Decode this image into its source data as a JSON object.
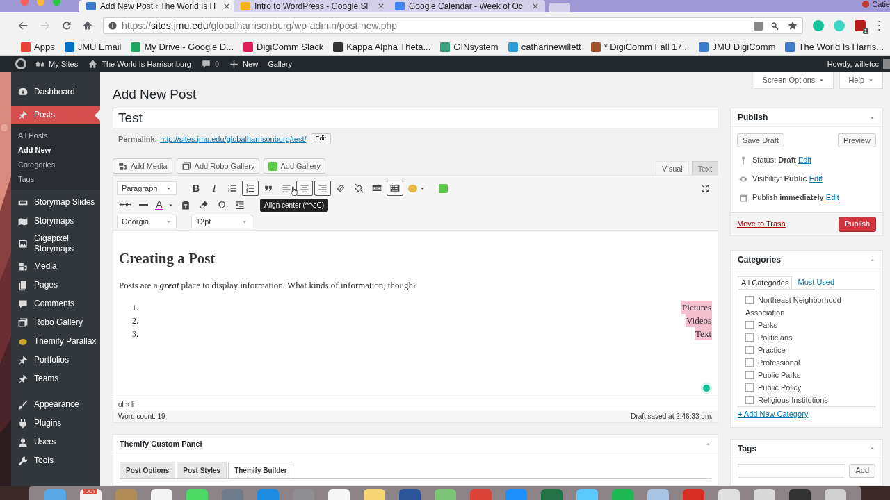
{
  "browser": {
    "tabs": [
      {
        "title": "Add New Post ‹ The World Is H",
        "selected": true,
        "color": "#3b7ccc"
      },
      {
        "title": "Intro to WordPress - Google Sl",
        "selected": false,
        "color": "#f4b400"
      },
      {
        "title": "Google Calendar - Week of Oc",
        "selected": false,
        "color": "#4285f4"
      }
    ],
    "profile": "Catie",
    "url": {
      "scheme": "https://",
      "host": "sites.jmu.edu",
      "path": "/globalharrisonburg/wp-admin/post-new.php"
    },
    "extension_badge": "1",
    "bookmarks": [
      {
        "label": "Apps",
        "color": "#e94235"
      },
      {
        "label": "JMU Email",
        "color": "#0072c6"
      },
      {
        "label": "My Drive - Google D...",
        "color": "#1fa463"
      },
      {
        "label": "DigiComm Slack",
        "color": "#e01e5a"
      },
      {
        "label": "Kappa Alpha Theta...",
        "color": "#333333"
      },
      {
        "label": "GINsystem",
        "color": "#3aa17e"
      },
      {
        "label": "catharinewillett",
        "color": "#2d9cdb"
      },
      {
        "label": "* DigiComm Fall 17...",
        "color": "#a0522d"
      },
      {
        "label": "JMU DigiComm",
        "color": "#3b7ccc"
      },
      {
        "label": "The World Is Harris...",
        "color": "#3b7ccc"
      }
    ]
  },
  "admin_bar": {
    "items": [
      {
        "label": "My Sites"
      },
      {
        "label": "The World Is Harrisonburg"
      },
      {
        "label": "0"
      },
      {
        "label": "New"
      },
      {
        "label": "Gallery"
      }
    ],
    "greeting": "Howdy, willetcc"
  },
  "sidebar": {
    "groups": [
      [
        {
          "label": "Dashboard",
          "selected": false
        }
      ],
      [
        {
          "label": "Posts",
          "selected": true,
          "children": [
            {
              "label": "All Posts",
              "selected": false
            },
            {
              "label": "Add New",
              "selected": true
            },
            {
              "label": "Categories",
              "selected": false
            },
            {
              "label": "Tags",
              "selected": false
            }
          ]
        },
        {
          "label": "Storymap Slides",
          "selected": false
        },
        {
          "label": "Storymaps",
          "selected": false
        },
        {
          "label": "Gigapixel Storymaps",
          "selected": false
        },
        {
          "label": "Media",
          "selected": false
        },
        {
          "label": "Pages",
          "selected": false
        },
        {
          "label": "Comments",
          "selected": false
        },
        {
          "label": "Robo Gallery",
          "selected": false
        },
        {
          "label": "Themify Parallax",
          "selected": false
        },
        {
          "label": "Portfolios",
          "selected": false
        },
        {
          "label": "Teams",
          "selected": false
        }
      ],
      [
        {
          "label": "Appearance",
          "selected": false
        },
        {
          "label": "Plugins",
          "selected": false
        },
        {
          "label": "Users",
          "selected": false
        },
        {
          "label": "Tools",
          "selected": false
        }
      ]
    ]
  },
  "page": {
    "title": "Add New Post",
    "screen_options": "Screen Options",
    "help": "Help"
  },
  "post": {
    "title_value": "Test",
    "permalink_label": "Permalink:",
    "permalink_url": "http://sites.jmu.edu/globalharrisonburg/test/",
    "permalink_edit": "Edit"
  },
  "media_buttons": [
    {
      "label": "Add Media"
    },
    {
      "label": "Add Robo Gallery"
    },
    {
      "label": "Add Gallery"
    }
  ],
  "editor_tabs": [
    {
      "label": "Visual",
      "selected": true
    },
    {
      "label": "Text",
      "selected": false
    }
  ],
  "toolbar": {
    "rows": [
      [
        {
          "kind": "select",
          "value": "Paragraph"
        },
        {
          "kind": "bold",
          "label": "B",
          "active": false
        },
        {
          "kind": "italic",
          "label": "I",
          "active": false
        },
        {
          "kind": "bullet-list",
          "active": false
        },
        {
          "kind": "numbered-list",
          "active": true
        },
        {
          "kind": "quote",
          "active": false
        },
        {
          "kind": "align-left",
          "active": false
        },
        {
          "kind": "align-center",
          "active": true
        },
        {
          "kind": "align-right",
          "active": true
        },
        {
          "kind": "link",
          "active": false
        },
        {
          "kind": "unlink",
          "active": false
        },
        {
          "kind": "read-more",
          "active": false
        },
        {
          "kind": "toolbar-toggle",
          "active": true
        },
        {
          "kind": "emoji",
          "active": false
        },
        {
          "kind": "square",
          "active": false
        }
      ],
      [
        {
          "kind": "strikethrough",
          "label": "ABC",
          "active": false
        },
        {
          "kind": "horizontal-line",
          "active": false
        },
        {
          "kind": "text-color",
          "label": "A",
          "active": false
        },
        {
          "kind": "paste-text",
          "active": false
        },
        {
          "kind": "eraser",
          "active": false
        },
        {
          "kind": "special-character",
          "label": "Ω",
          "active": false
        },
        {
          "kind": "outdent",
          "active": false
        }
      ],
      [
        {
          "kind": "select",
          "value": "Georgia"
        },
        {
          "kind": "select",
          "value": "12pt"
        }
      ]
    ],
    "tooltip": "Align center (^⌥C)"
  },
  "content": {
    "heading": "Creating a Post",
    "paragraph": [
      {
        "text": "Posts are a "
      },
      {
        "text": "great",
        "bold": true,
        "italic": true
      },
      {
        "text": " place to display information. What kinds of information, though?"
      }
    ],
    "list": [
      {
        "number": "1.",
        "text": "Pictures"
      },
      {
        "number": "2.",
        "text": "Videos"
      },
      {
        "number": "3.",
        "text": "Text"
      }
    ]
  },
  "path": "ol » li",
  "word_count": "Word count: 19",
  "saved": "Draft saved at 2:46:33 pm.",
  "custom_panel": {
    "title": "Themify Custom Panel",
    "tabs": [
      {
        "label": "Post Options",
        "selected": false
      },
      {
        "label": "Post Styles",
        "selected": false
      },
      {
        "label": "Themify Builder",
        "selected": true
      }
    ]
  },
  "publish": {
    "title": "Publish",
    "save_draft": "Save Draft",
    "preview": "Preview",
    "rows": [
      {
        "text": "Status: **Draft**",
        "link": "Edit"
      },
      {
        "text": "Visibility: **Public**",
        "link": "Edit"
      },
      {
        "text": "Publish **immediately**",
        "link": "Edit"
      }
    ],
    "trash": "Move to Trash",
    "publish_button": "Publish"
  },
  "categories": {
    "title": "Categories",
    "tabs": [
      {
        "label": "All Categories",
        "selected": true
      },
      {
        "label": "Most Used",
        "selected": false
      }
    ],
    "items": [
      {
        "label": "Northeast Neighborhood Association",
        "checked": false
      },
      {
        "label": "Parks",
        "checked": false
      },
      {
        "label": "Politicians",
        "checked": false
      },
      {
        "label": "Practice",
        "checked": false
      },
      {
        "label": "Professional",
        "checked": false
      },
      {
        "label": "Public Parks",
        "checked": false
      },
      {
        "label": "Public Policy",
        "checked": false
      },
      {
        "label": "Religious Institutions",
        "checked": false
      }
    ],
    "add_new": "+ Add New Category"
  },
  "tags": {
    "title": "Tags",
    "add": "Add"
  },
  "dock": {
    "items": [
      {
        "color": "#5aa9e6"
      },
      {
        "color": "#f2f2f2",
        "label": "OCT"
      },
      {
        "color": "#b08d57"
      },
      {
        "color": "#f5f5f5"
      },
      {
        "color": "#4cd964"
      },
      {
        "color": "#6d7b8d"
      },
      {
        "color": "#1d8ce0"
      },
      {
        "color": "#8e8e93"
      },
      {
        "color": "#f6f6f6"
      },
      {
        "color": "#f7d774"
      },
      {
        "color": "#2b579a"
      },
      {
        "color": "#7cc576"
      },
      {
        "color": "#db4437"
      },
      {
        "color": "#1e90ff"
      },
      {
        "color": "#217346"
      },
      {
        "color": "#5ac8fa"
      },
      {
        "color": "#1db954"
      },
      {
        "color": "#a7c4e5"
      },
      {
        "color": "#d93025"
      },
      {
        "color": "#e0e0e0"
      },
      {
        "color": "#d9d9d9"
      },
      {
        "color": "#333333"
      },
      {
        "color": "#cfcfcf"
      }
    ]
  }
}
